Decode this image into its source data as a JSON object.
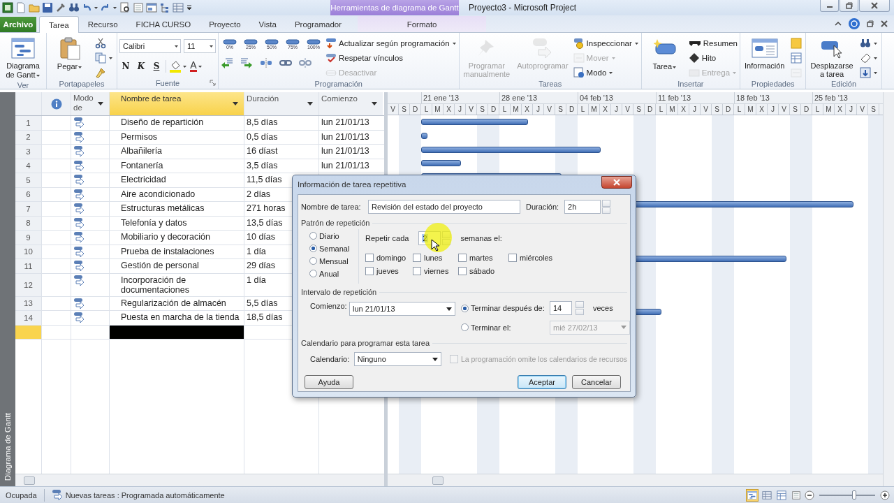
{
  "title_bar": {
    "context_tab": "Herramientas de diagrama de Gantt",
    "title": "Proyecto3  -  Microsoft Project"
  },
  "tabs": [
    {
      "label": "Archivo",
      "kind": "file",
      "selected": false
    },
    {
      "label": "Tarea",
      "kind": "normal",
      "selected": true
    },
    {
      "label": "Recurso",
      "kind": "normal",
      "selected": false
    },
    {
      "label": "FICHA CURSO",
      "kind": "normal",
      "selected": false
    },
    {
      "label": "Proyecto",
      "kind": "normal",
      "selected": false
    },
    {
      "label": "Vista",
      "kind": "normal",
      "selected": false
    },
    {
      "label": "Programador",
      "kind": "normal",
      "selected": false
    },
    {
      "label": "Formato",
      "kind": "context",
      "selected": false
    }
  ],
  "ribbon": [
    {
      "label": "Ver",
      "kind": "basic",
      "large": [
        {
          "label": "Diagrama de Gantt",
          "dropdown": true,
          "disabled": false
        }
      ]
    },
    {
      "label": "Portapapeles",
      "kind": "basic",
      "large": [
        {
          "label": "Pegar",
          "dropdown": true,
          "disabled": false
        }
      ],
      "small": [
        {
          "dropdown": false,
          "disabled": false
        },
        {
          "dropdown": true,
          "disabled": false
        },
        {
          "dropdown": false,
          "disabled": false
        }
      ]
    },
    {
      "label": "Fuente",
      "kind": "font",
      "font": "Calibri",
      "size": "11",
      "styles": [
        "N",
        "K",
        "S"
      ],
      "color_glyph": "A"
    },
    {
      "label": "Programación",
      "kind": "schedule",
      "percent": [
        "0%",
        "25%",
        "50%",
        "75%",
        "100%"
      ],
      "small": [
        {
          "label": "Actualizar según programación",
          "dropdown": true,
          "disabled": false
        },
        {
          "label": "Respetar vínculos",
          "dropdown": false,
          "disabled": false
        },
        {
          "label": "Desactivar",
          "dropdown": false,
          "disabled": true
        }
      ]
    },
    {
      "label": "Tareas",
      "kind": "basic",
      "large": [
        {
          "label": "Programar manualmente",
          "dropdown": false,
          "disabled": true
        },
        {
          "label": "Autoprogramar",
          "dropdown": false,
          "disabled": true
        }
      ],
      "small": [
        {
          "label": "Inspeccionar",
          "dropdown": true,
          "disabled": false
        },
        {
          "label": "Mover",
          "dropdown": true,
          "disabled": true
        },
        {
          "label": "Modo",
          "dropdown": true,
          "disabled": false
        }
      ]
    },
    {
      "label": "Insertar",
      "kind": "basic",
      "large": [
        {
          "label": "Tarea",
          "dropdown": true,
          "disabled": false
        }
      ],
      "small": [
        {
          "label": "Resumen",
          "dropdown": false,
          "disabled": false
        },
        {
          "label": "Hito",
          "dropdown": false,
          "disabled": false
        },
        {
          "label": "Entrega",
          "dropdown": true,
          "disabled": true
        }
      ]
    },
    {
      "label": "Propiedades",
      "kind": "basic",
      "large": [
        {
          "label": "Información",
          "dropdown": false,
          "disabled": false
        }
      ],
      "small": [
        {
          "dropdown": false,
          "disabled": false
        },
        {
          "dropdown": false,
          "disabled": false
        },
        {
          "dropdown": false,
          "disabled": true
        }
      ]
    },
    {
      "label": "Edición",
      "kind": "basic",
      "large": [
        {
          "label": "Desplazarse a tarea",
          "dropdown": false,
          "disabled": false
        }
      ],
      "small": [
        {
          "dropdown": true,
          "disabled": false
        },
        {
          "dropdown": true,
          "disabled": false
        },
        {
          "dropdown": true,
          "disabled": false
        }
      ]
    }
  ],
  "view_bar": {
    "label": "Diagrama de Gantt"
  },
  "table": {
    "columns": [
      {
        "label": "Modo de",
        "selected": false
      },
      {
        "label": "Nombre de tarea",
        "selected": true
      },
      {
        "label": "Duración",
        "selected": false
      },
      {
        "label": "Comienzo",
        "selected": false
      }
    ],
    "rows": [
      {
        "id": "1",
        "name": "Diseño de repartición",
        "duration": "8,5 días",
        "start": "lun 21/01/13",
        "selected": false
      },
      {
        "id": "2",
        "name": "Permisos",
        "duration": "0,5 días",
        "start": "lun 21/01/13",
        "selected": false
      },
      {
        "id": "3",
        "name": "Albañilería",
        "duration": "16 díast",
        "start": "lun 21/01/13",
        "selected": false
      },
      {
        "id": "4",
        "name": "Fontanería",
        "duration": "3,5 días",
        "start": "lun 21/01/13",
        "selected": false
      },
      {
        "id": "5",
        "name": "Electricidad",
        "duration": "11,5 días",
        "selected": false
      },
      {
        "id": "6",
        "name": "Aire acondicionado",
        "duration": "2 días",
        "selected": false
      },
      {
        "id": "7",
        "name": "Estructuras metálicas",
        "duration": "271 horas",
        "selected": false
      },
      {
        "id": "8",
        "name": "Telefonía y datos",
        "duration": "13,5 días",
        "selected": false
      },
      {
        "id": "9",
        "name": "Mobiliario y decoración",
        "duration": "10 días",
        "selected": false
      },
      {
        "id": "10",
        "name": "Prueba de instalaciones",
        "duration": "1 día",
        "selected": false
      },
      {
        "id": "11",
        "name": "Gestión de personal",
        "duration": "29 días",
        "selected": false
      },
      {
        "id": "12",
        "name": "Incorporación de documentaciones",
        "duration": "1 día",
        "selected": false
      },
      {
        "id": "13",
        "name": "Regularización de almacén",
        "duration": "5,5 días",
        "selected": false
      },
      {
        "id": "14",
        "name": "Puesta en marcha de la tienda",
        "duration": "18,5 días",
        "selected": false
      },
      {
        "kind": "new",
        "selected": true
      }
    ]
  },
  "gantt": {
    "weeks": [
      "21 ene '13",
      "28 ene '13",
      "04 feb '13",
      "11 feb '13",
      "18 feb '13",
      "25 feb '13"
    ],
    "days": [
      "V",
      "S",
      "D",
      "L",
      "M",
      "X",
      "J",
      "V",
      "S",
      "D",
      "L",
      "M",
      "X",
      "J",
      "V",
      "S",
      "D",
      "L",
      "M",
      "X",
      "J",
      "V",
      "S",
      "D",
      "L",
      "M",
      "X",
      "J",
      "V",
      "S",
      "D",
      "L",
      "M",
      "X",
      "J",
      "V",
      "S",
      "D",
      "L",
      "M",
      "X",
      "J",
      "V",
      "S"
    ]
  },
  "dialog": {
    "title": "Información de tarea repetitiva",
    "task_name_label": "Nombre de tarea:",
    "task_name": "Revisión del estado del proyecto",
    "duration_label": "Duración:",
    "duration": "2h",
    "pattern_heading": "Patrón de repetición",
    "patterns": [
      {
        "label": "Diario",
        "selected": false
      },
      {
        "label": "Semanal",
        "selected": true
      },
      {
        "label": "Mensual",
        "selected": false
      },
      {
        "label": "Anual",
        "selected": false
      }
    ],
    "repeat_label": "Repetir cada",
    "repeat_value": "2",
    "repeat_unit": "semanas el:",
    "weekdays": [
      {
        "label": "domingo",
        "checked": false
      },
      {
        "label": "lunes",
        "checked": false
      },
      {
        "label": "martes",
        "checked": false
      },
      {
        "label": "miércoles",
        "checked": false
      },
      {
        "label": "jueves",
        "checked": false
      },
      {
        "label": "viernes",
        "checked": false
      },
      {
        "label": "sábado",
        "checked": false
      }
    ],
    "range_heading": "Intervalo de repetición",
    "start_label": "Comienzo:",
    "start_value": "lun 21/01/13",
    "end_options": [
      {
        "kind": "count",
        "label": "Terminar después de:",
        "selected": true,
        "value": "14",
        "suffix": "veces",
        "disabled": false
      },
      {
        "kind": "date",
        "label": "Terminar el:",
        "selected": false,
        "value": "mié 27/02/13",
        "disabled": true
      }
    ],
    "calendar_heading": "Calendario para programar esta tarea",
    "calendar_label": "Calendario:",
    "calendar_value": "Ninguno",
    "ignore_resources": {
      "label": "La programación omite los calendarios de recursos",
      "checked": false,
      "disabled": true
    },
    "buttons": [
      {
        "label": "Ayuda",
        "default": false
      },
      {
        "label": "Aceptar",
        "default": true
      },
      {
        "label": "Cancelar",
        "default": false
      }
    ]
  },
  "status_bar": {
    "state": "Ocupada",
    "new_tasks": "Nuevas tareas : Programada automáticamente",
    "zoom": {
      "level": 0.62
    }
  }
}
